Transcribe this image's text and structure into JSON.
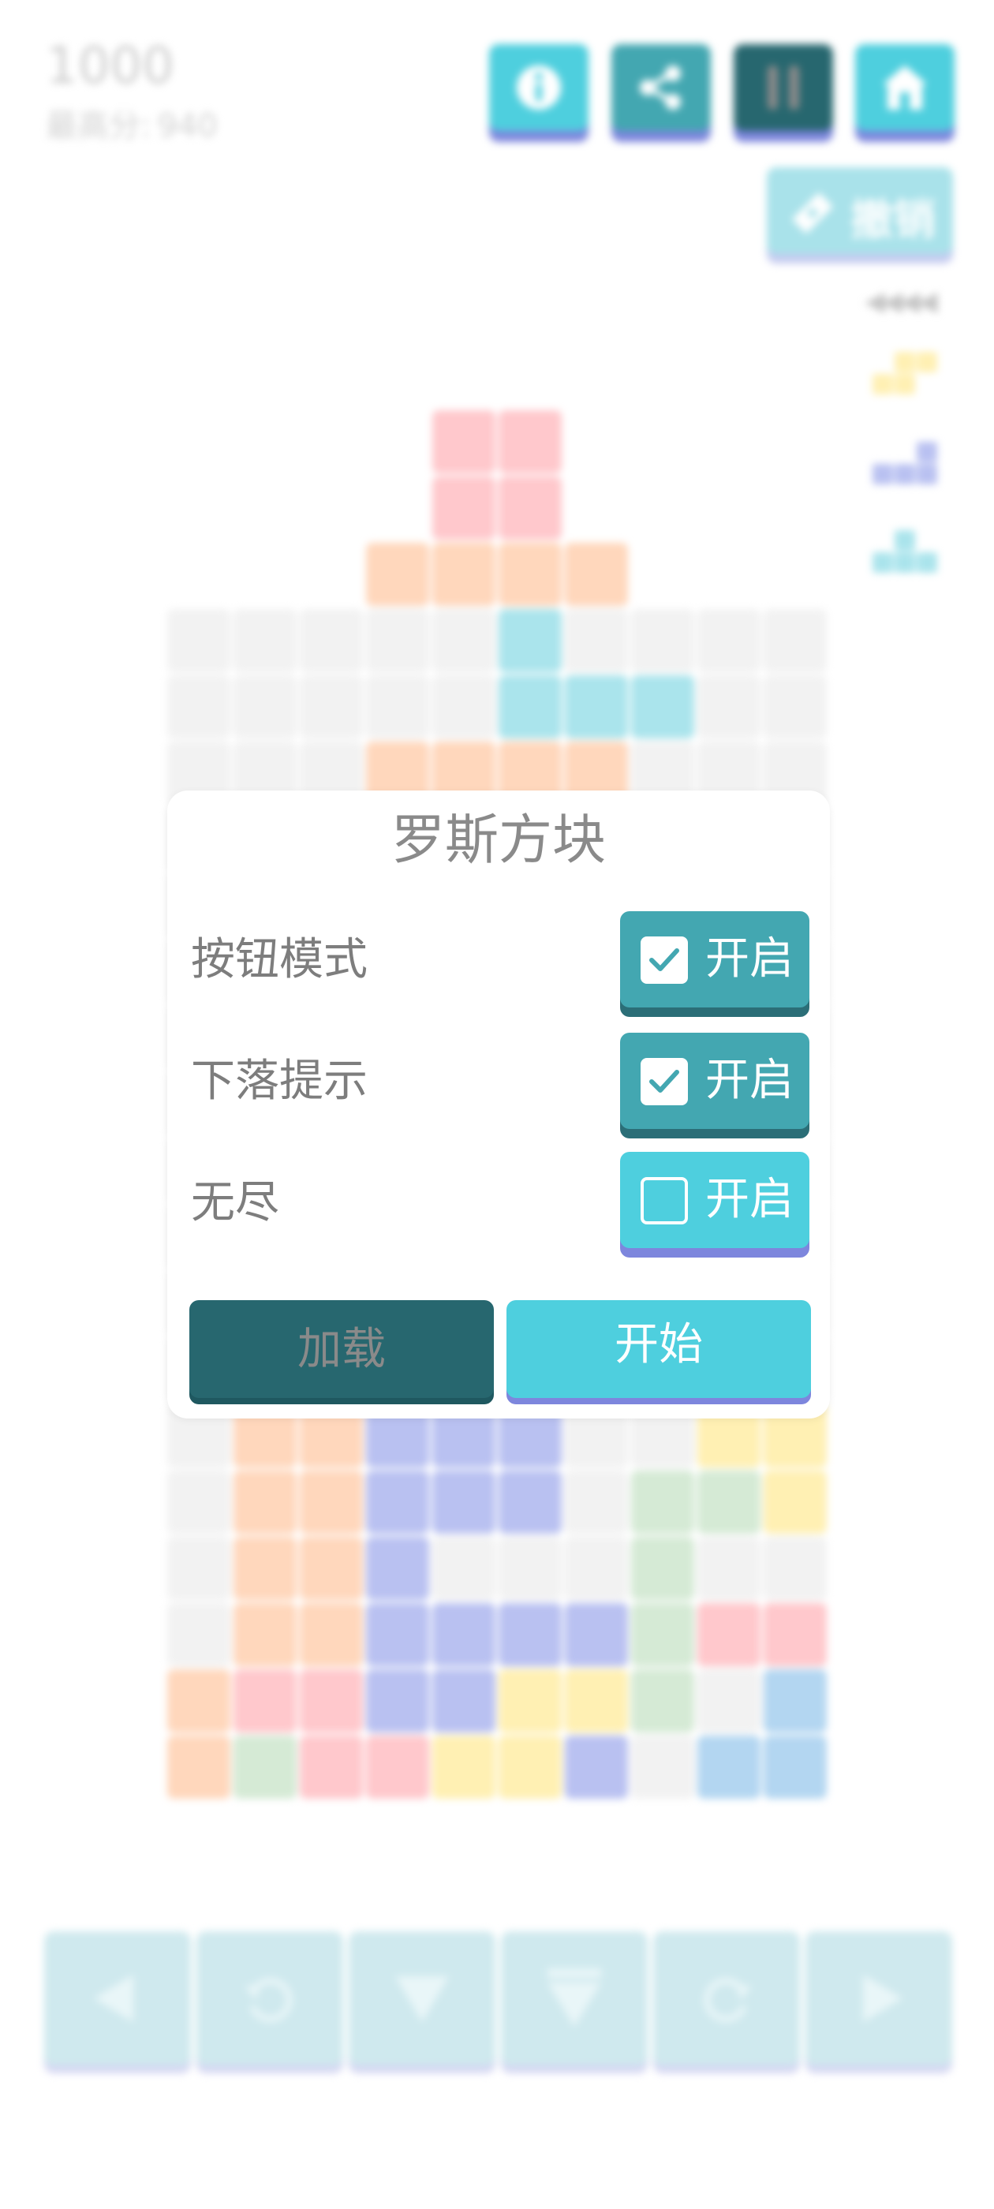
{
  "score": {
    "current": "1000",
    "best_label": "最高分:",
    "best_value": "940"
  },
  "top_buttons": [
    {
      "name": "info-button",
      "icon": "info-icon",
      "color": "#4ecfde"
    },
    {
      "name": "share-button",
      "icon": "share-icon",
      "color": "#43a7b1"
    },
    {
      "name": "pause-button",
      "icon": "pause-icon",
      "color": "#27676f"
    },
    {
      "name": "home-button",
      "icon": "home-icon",
      "color": "#4ecfde"
    }
  ],
  "undo": {
    "label": "撤销",
    "icon": "ticket-icon"
  },
  "queue_indicator": "◀◀◀◀",
  "next_pieces": [
    "S-piece-yellow",
    "L-piece-purple",
    "T-piece-cyan"
  ],
  "colors": {
    "pink": "#ffc8cc",
    "orange": "#ffd7bc",
    "cyan": "#aae4ec",
    "purple": "#b9c1f1",
    "yellow": "#fff0b3",
    "green": "#d5ead5",
    "blue": "#b3d6f1",
    "empty": "#f2f2f2",
    "teal_dark": "#27676f",
    "teal": "#43a7b1",
    "cyan_btn": "#4ecfde",
    "indigo_shadow": "#7d86dd"
  },
  "controls": [
    {
      "name": "move-left-button",
      "icon": "left-arrow-icon"
    },
    {
      "name": "rotate-left-button",
      "icon": "rotate-ccw-icon"
    },
    {
      "name": "soft-drop-button",
      "icon": "down-arrow-icon"
    },
    {
      "name": "hard-drop-button",
      "icon": "double-down-icon"
    },
    {
      "name": "rotate-right-button",
      "icon": "rotate-cw-icon"
    },
    {
      "name": "move-right-button",
      "icon": "right-arrow-icon"
    }
  ],
  "dialog": {
    "title": "罗斯方块",
    "options": [
      {
        "label": "按钮模式",
        "toggle_label": "开启",
        "checked": true
      },
      {
        "label": "下落提示",
        "toggle_label": "开启",
        "checked": true
      },
      {
        "label": "无尽",
        "toggle_label": "开启",
        "checked": false
      }
    ],
    "load_label": "加载",
    "start_label": "开始"
  }
}
